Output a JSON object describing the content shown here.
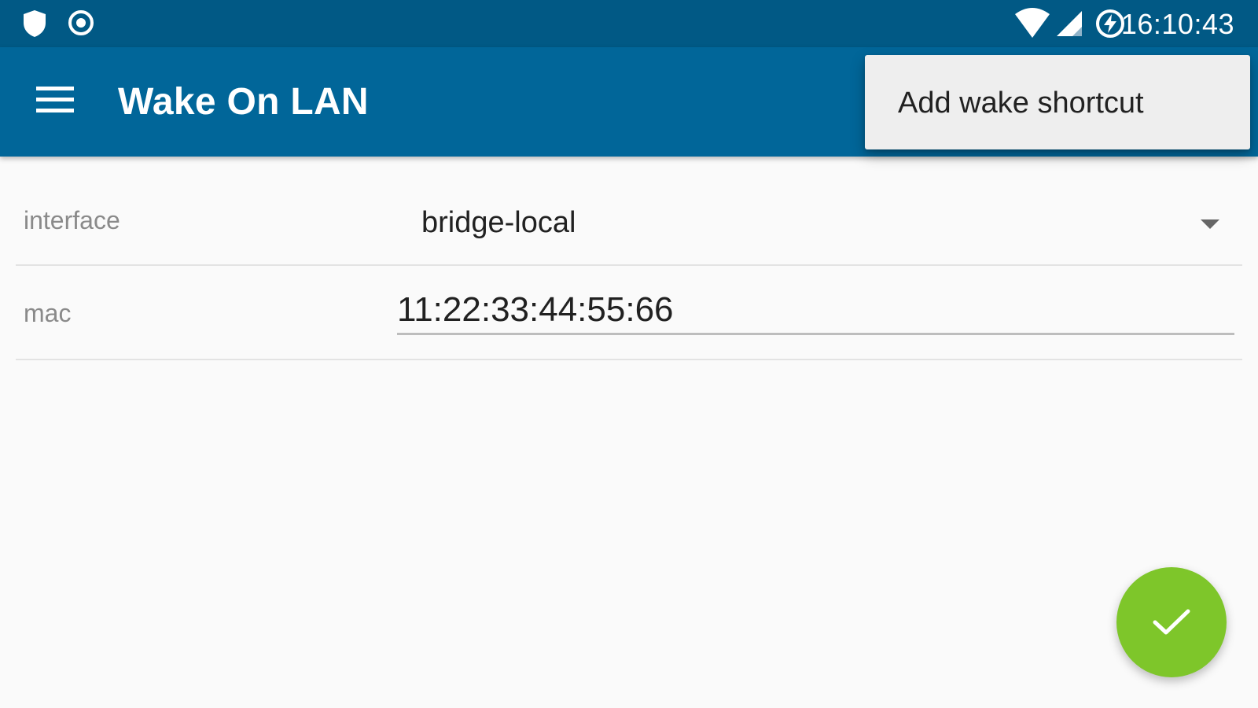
{
  "status_bar": {
    "time": "16:10:43",
    "icons": [
      "shield-icon",
      "record-icon",
      "wifi-icon",
      "cell-signal-icon",
      "battery-saver-icon"
    ]
  },
  "app_bar": {
    "title": "Wake On LAN",
    "menu_icon": "hamburger-menu-icon",
    "color": "#016699"
  },
  "popup_menu": {
    "items": [
      "Add wake shortcut"
    ]
  },
  "form": {
    "interface": {
      "label": "interface",
      "value": "bridge-local"
    },
    "mac": {
      "label": "mac",
      "value": "11:22:33:44:55:66"
    }
  },
  "fab": {
    "icon": "checkmark-icon",
    "color": "#7ec62a"
  }
}
